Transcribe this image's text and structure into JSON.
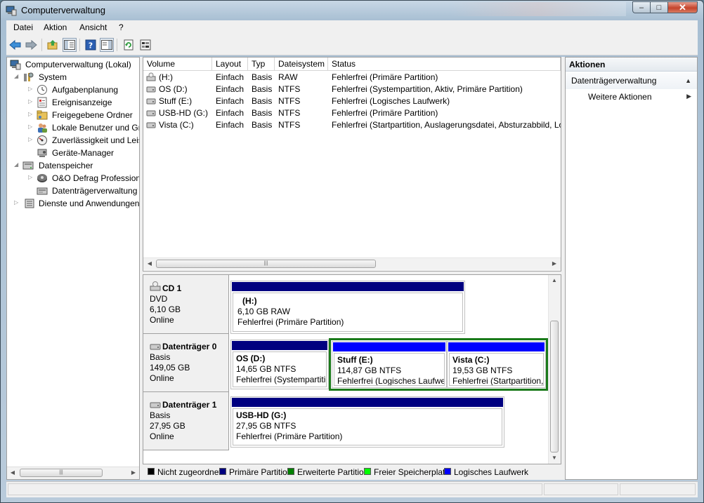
{
  "window": {
    "title": "Computerverwaltung"
  },
  "menu": [
    "Datei",
    "Aktion",
    "Ansicht",
    "?"
  ],
  "toolbar": {
    "buttons": [
      "back-icon",
      "forward-icon",
      "up-folder-icon",
      "show-hide-tree-icon",
      "help-icon",
      "show-hide-action-icon",
      "refresh-icon",
      "properties-icon"
    ]
  },
  "tree": {
    "root": "Computerverwaltung (Lokal)",
    "system": "System",
    "system_children": [
      "Aufgabenplanung",
      "Ereignisanzeige",
      "Freigegebene Ordner",
      "Lokale Benutzer und Gruppen",
      "Zuverlässigkeit und Leistung",
      "Geräte-Manager"
    ],
    "storage": "Datenspeicher",
    "storage_children": [
      "O&O Defrag Professional",
      "Datenträgerverwaltung"
    ],
    "services": "Dienste und Anwendungen"
  },
  "volume_list": {
    "columns": [
      "Volume",
      "Layout",
      "Typ",
      "Dateisystem",
      "Status"
    ],
    "rows": [
      {
        "volume": "(H:)",
        "layout": "Einfach",
        "typ": "Basis",
        "fs": "RAW",
        "status": "Fehlerfrei (Primäre Partition)"
      },
      {
        "volume": "OS (D:)",
        "layout": "Einfach",
        "typ": "Basis",
        "fs": "NTFS",
        "status": "Fehlerfrei (Systempartition, Aktiv, Primäre Partition)"
      },
      {
        "volume": "Stuff (E:)",
        "layout": "Einfach",
        "typ": "Basis",
        "fs": "NTFS",
        "status": "Fehlerfrei (Logisches Laufwerk)"
      },
      {
        "volume": "USB-HD (G:)",
        "layout": "Einfach",
        "typ": "Basis",
        "fs": "NTFS",
        "status": "Fehlerfrei (Primäre Partition)"
      },
      {
        "volume": "Vista (C:)",
        "layout": "Einfach",
        "typ": "Basis",
        "fs": "NTFS",
        "status": "Fehlerfrei (Startpartition, Auslagerungsdatei, Absturzabbild, Logisches Laufwerk)"
      }
    ]
  },
  "disks": [
    {
      "name": "CD 1",
      "type": "DVD",
      "size": "6,10 GB",
      "state": "Online",
      "partitions": [
        {
          "title": "(H:)",
          "detail": "6,10 GB RAW",
          "status": "Fehlerfrei (Primäre Partition)"
        }
      ]
    },
    {
      "name": "Datenträger 0",
      "type": "Basis",
      "size": "149,05 GB",
      "state": "Online",
      "partitions": [
        {
          "title": "OS  (D:)",
          "detail": "14,65 GB NTFS",
          "status": "Fehlerfrei (Systempartition, Aktiv, Primäre Partition)"
        },
        {
          "title": "Stuff  (E:)",
          "detail": "114,87 GB NTFS",
          "status": "Fehlerfrei (Logisches Laufwerk)"
        },
        {
          "title": "Vista  (C:)",
          "detail": "19,53 GB NTFS",
          "status": "Fehlerfrei (Startpartition, Auslagerungsdatei, Absturzabbild, Logisches Laufwerk)"
        }
      ]
    },
    {
      "name": "Datenträger 1",
      "type": "Basis",
      "size": "27,95 GB",
      "state": "Online",
      "partitions": [
        {
          "title": "USB-HD  (G:)",
          "detail": "27,95 GB NTFS",
          "status": "Fehlerfrei (Primäre Partition)"
        }
      ]
    }
  ],
  "legend": [
    {
      "label": "Nicht zugeordnet",
      "color": "#000000"
    },
    {
      "label": "Primäre Partition",
      "color": "#000080"
    },
    {
      "label": "Erweiterte Partition",
      "color": "#008000"
    },
    {
      "label": "Freier Speicherplatz",
      "color": "#00ff00"
    },
    {
      "label": "Logisches Laufwerk",
      "color": "#0000ff"
    }
  ],
  "actions": {
    "header": "Aktionen",
    "section": "Datenträgerverwaltung",
    "item": "Weitere Aktionen"
  },
  "colors": {
    "primary": "#000080",
    "logical": "#0000ff",
    "extended": "#008000"
  }
}
